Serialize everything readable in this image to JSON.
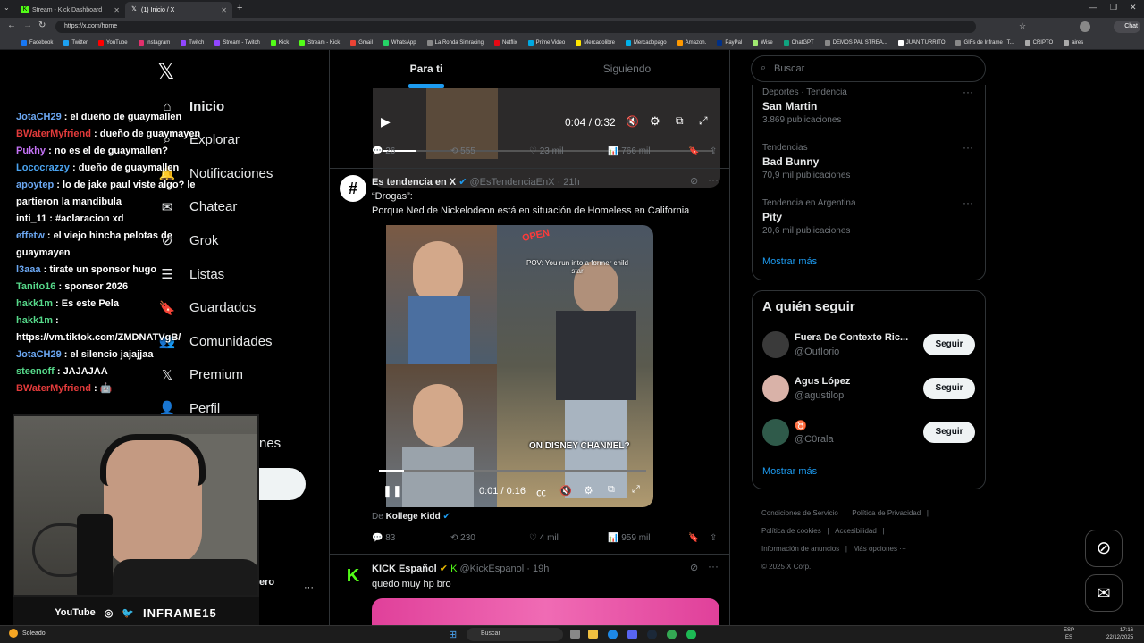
{
  "browser": {
    "tabs": [
      {
        "title": "Stream - Kick Dashboard"
      },
      {
        "title": "(1) Inicio / X"
      }
    ],
    "url": "https://x.com/home",
    "bookmarks": [
      "Facebook",
      "Twitter",
      "YouTube",
      "Instagram",
      "Twitch",
      "Stream - Twitch",
      "Kick",
      "Stream - Kick",
      "Gmail",
      "WhatsApp",
      "La Ronda Simracing",
      "Netflix",
      "Prime Video",
      "Mercadolibre",
      "Mercadopago",
      "Amazon.",
      "PayPal",
      "Wise",
      "ChatGPT",
      "DEMOS PAL STREA...",
      "JUAN TURRITO",
      "GIFs de Inframe | T...",
      "CRIPTO",
      "aires"
    ],
    "profile_label": "Chat"
  },
  "nav": {
    "items": [
      {
        "label": "Inicio",
        "icon": "home-icon"
      },
      {
        "label": "Explorar",
        "icon": "search-icon"
      },
      {
        "label": "Notificaciones",
        "icon": "bell-icon"
      },
      {
        "label": "Chatear",
        "icon": "mail-icon"
      },
      {
        "label": "Grok",
        "icon": "grok-icon"
      },
      {
        "label": "Listas",
        "icon": "list-icon"
      },
      {
        "label": "Guardados",
        "icon": "bookmark-icon"
      },
      {
        "label": "Comunidades",
        "icon": "communities-icon"
      },
      {
        "label": "Premium",
        "icon": "x-icon"
      },
      {
        "label": "Perfil",
        "icon": "profile-icon"
      }
    ],
    "partial_more": "nes",
    "account_partial": "ero",
    "more_dots": "···"
  },
  "chat": [
    {
      "user": "JotaCH29",
      "color": "#6ba7f2",
      "text": "el dueño de guaymallen"
    },
    {
      "user": "BWaterMyfriend",
      "color": "#e33b3b",
      "text": "dueño de guaymayen"
    },
    {
      "user": "Pukhy",
      "color": "#c472f5",
      "text": "no es el de guaymallen?"
    },
    {
      "user": "Lococrazzy",
      "color": "#4aa3f0",
      "text": "dueño de guaymallen"
    },
    {
      "user": "apoytep",
      "color": "#6ba7f2",
      "text": "lo de jake paul viste algo? le partieron la mandibula"
    },
    {
      "user": "inti_11",
      "color": "#ffffff",
      "text": "#aclaracion xd"
    },
    {
      "user": "effetw",
      "color": "#6ba7f2",
      "text": "el viejo hincha pelotas de guaymayen"
    },
    {
      "user": "l3aaa",
      "color": "#6ba7f2",
      "text": "tirate un sponsor hugo"
    },
    {
      "user": "Tanito16",
      "color": "#56d98a",
      "text": "sponsor 2026"
    },
    {
      "user": "hakk1m",
      "color": "#56d98a",
      "text": "Es este Pela"
    },
    {
      "user": "hakk1m",
      "color": "#56d98a",
      "text": "https://vm.tiktok.com/ZMDNATVgB/"
    },
    {
      "user": "JotaCH29",
      "color": "#6ba7f2",
      "text": "el silencio jajajjaa"
    },
    {
      "user": "steenoff",
      "color": "#56d98a",
      "text": "JAJAJAA"
    },
    {
      "user": "BWaterMyfriend",
      "color": "#e33b3b",
      "text": "🤖"
    }
  ],
  "webcam": {
    "socials": [
      "YouTube",
      "INFRAME15"
    ]
  },
  "feed": {
    "tabs": [
      {
        "label": "Para ti"
      },
      {
        "label": "Siguiendo"
      }
    ],
    "video1": {
      "time": "0:04 / 0:32"
    },
    "post1_stats": {
      "replies": "26",
      "reposts": "555",
      "likes": "23 mil",
      "views": "766 mil"
    },
    "post2": {
      "name": "Es tendencia en X",
      "handle": "@EsTendenciaEnX",
      "time": "· 21h",
      "line1": "“Drogas”:",
      "line2": "Porque Ned de Nickelodeon está en situación de Homeless en California",
      "video_caption1": "POV: You run into a former child star",
      "video_caption2": "ON DISNEY CHANNEL?",
      "video_sign": "OPEN",
      "video_time": "0:01 / 0:16",
      "from_label": "De",
      "from_name": "Kollege Kidd",
      "stats": {
        "replies": "83",
        "reposts": "230",
        "likes": "4 mil",
        "views": "959 mil"
      }
    },
    "post3": {
      "name": "KICK Español",
      "handle": "@KickEspanol",
      "time": "· 19h",
      "text": "quedo muy hp bro"
    }
  },
  "sidebar": {
    "search_placeholder": "Buscar",
    "trends": [
      {
        "category": "Deportes · Tendencia",
        "name": "San Martin",
        "count": "3.869 publicaciones"
      },
      {
        "category": "Tendencias",
        "name": "Bad Bunny",
        "count": "70,9 mil publicaciones"
      },
      {
        "category": "Tendencia en Argentina",
        "name": "Pity",
        "count": "20,6 mil publicaciones"
      }
    ],
    "show_more": "Mostrar más",
    "who_to_follow_title": "A quién seguir",
    "follow": [
      {
        "name": "Fuera De Contexto Ric...",
        "handle": "@OutIorio",
        "button": "Seguir"
      },
      {
        "name": "Agus López",
        "handle": "@agustilop",
        "button": "Seguir"
      },
      {
        "name": "♉",
        "handle": "@C0rala",
        "button": "Seguir"
      }
    ],
    "footer": [
      "Condiciones de Servicio",
      "Política de Privacidad",
      "Política de cookies",
      "Accesibilidad",
      "Información de anuncios",
      "Más opciones ···",
      "© 2025 X Corp."
    ]
  },
  "taskbar": {
    "weather": "Soleado",
    "search": "Buscar",
    "lang1": "ESP",
    "lang2": "ES",
    "time": "17:16",
    "date": "22/12/2025"
  }
}
